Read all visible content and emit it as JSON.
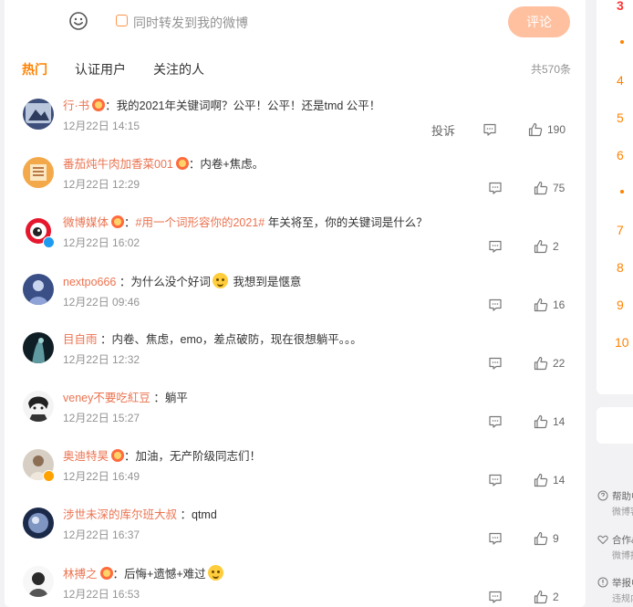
{
  "composer": {
    "forward_label": "同时转发到我的微博",
    "submit_label": "评论"
  },
  "tabs": {
    "hot": "热门",
    "verified": "认证用户",
    "following": "关注的人",
    "total": "共570条"
  },
  "comments": [
    {
      "user": "行·书",
      "medal": true,
      "text": "：我的2021年关键词啊？公平！公平！还是tmd 公平！",
      "time": "12月22日 14:15",
      "report": "投诉",
      "likes": "190"
    },
    {
      "user": "番茄炖牛肉加香菜001",
      "medal": true,
      "text": "：内卷+焦虑。",
      "time": "12月22日 12:29",
      "likes": "75"
    },
    {
      "user": "微博媒体",
      "medal": true,
      "hashtag": "#用一个词形容你的2021#",
      "text": " 年关将至，你的关键词是什么？",
      "time": "12月22日 16:02",
      "likes": "2",
      "verified": "blue"
    },
    {
      "user": "nextpo666",
      "text": " ：为什么没个好词",
      "text2": " 我想到是惬意",
      "emoji": true,
      "time": "12月22日 09:46",
      "likes": "16"
    },
    {
      "user": "目自雨",
      "text": " ：内卷、焦虑，emo，差点破防，现在很想躺平。。。",
      "time": "12月22日 12:32",
      "likes": "22"
    },
    {
      "user": "veney不要吃紅豆",
      "text": " ：躺平",
      "time": "12月22日 15:27",
      "likes": "14"
    },
    {
      "user": "奥迪特昊",
      "medal": true,
      "text": "：加油，无产阶级同志们！",
      "time": "12月22日 16:49",
      "likes": "14",
      "verified": "gold"
    },
    {
      "user": "涉世未深的库尔班大叔",
      "text": " ：qtmd",
      "time": "12月22日 16:37",
      "likes": "9"
    },
    {
      "user": "林搏之",
      "medal": true,
      "text": "：后悔+遗憾+难过",
      "emoji": true,
      "time": "12月22日 16:53",
      "likes": "2"
    }
  ],
  "rank": [
    "3",
    "4",
    "5",
    "6",
    "7",
    "8",
    "9",
    "10"
  ],
  "side_links": [
    {
      "title": "帮助中心",
      "sub": "微博客服"
    },
    {
      "title": "合作&服务",
      "sub": "微博招聘"
    },
    {
      "title": "举报中心",
      "sub": "违规内容"
    }
  ],
  "colors": {
    "accent": "#ff8200",
    "username": "#eb7350",
    "submit_bg": "#ffc09f"
  },
  "icons": [
    "smile-icon",
    "reply-icon",
    "like-icon",
    "medal-icon",
    "verified-icon",
    "help-icon",
    "cooperation-icon",
    "report-icon"
  ]
}
